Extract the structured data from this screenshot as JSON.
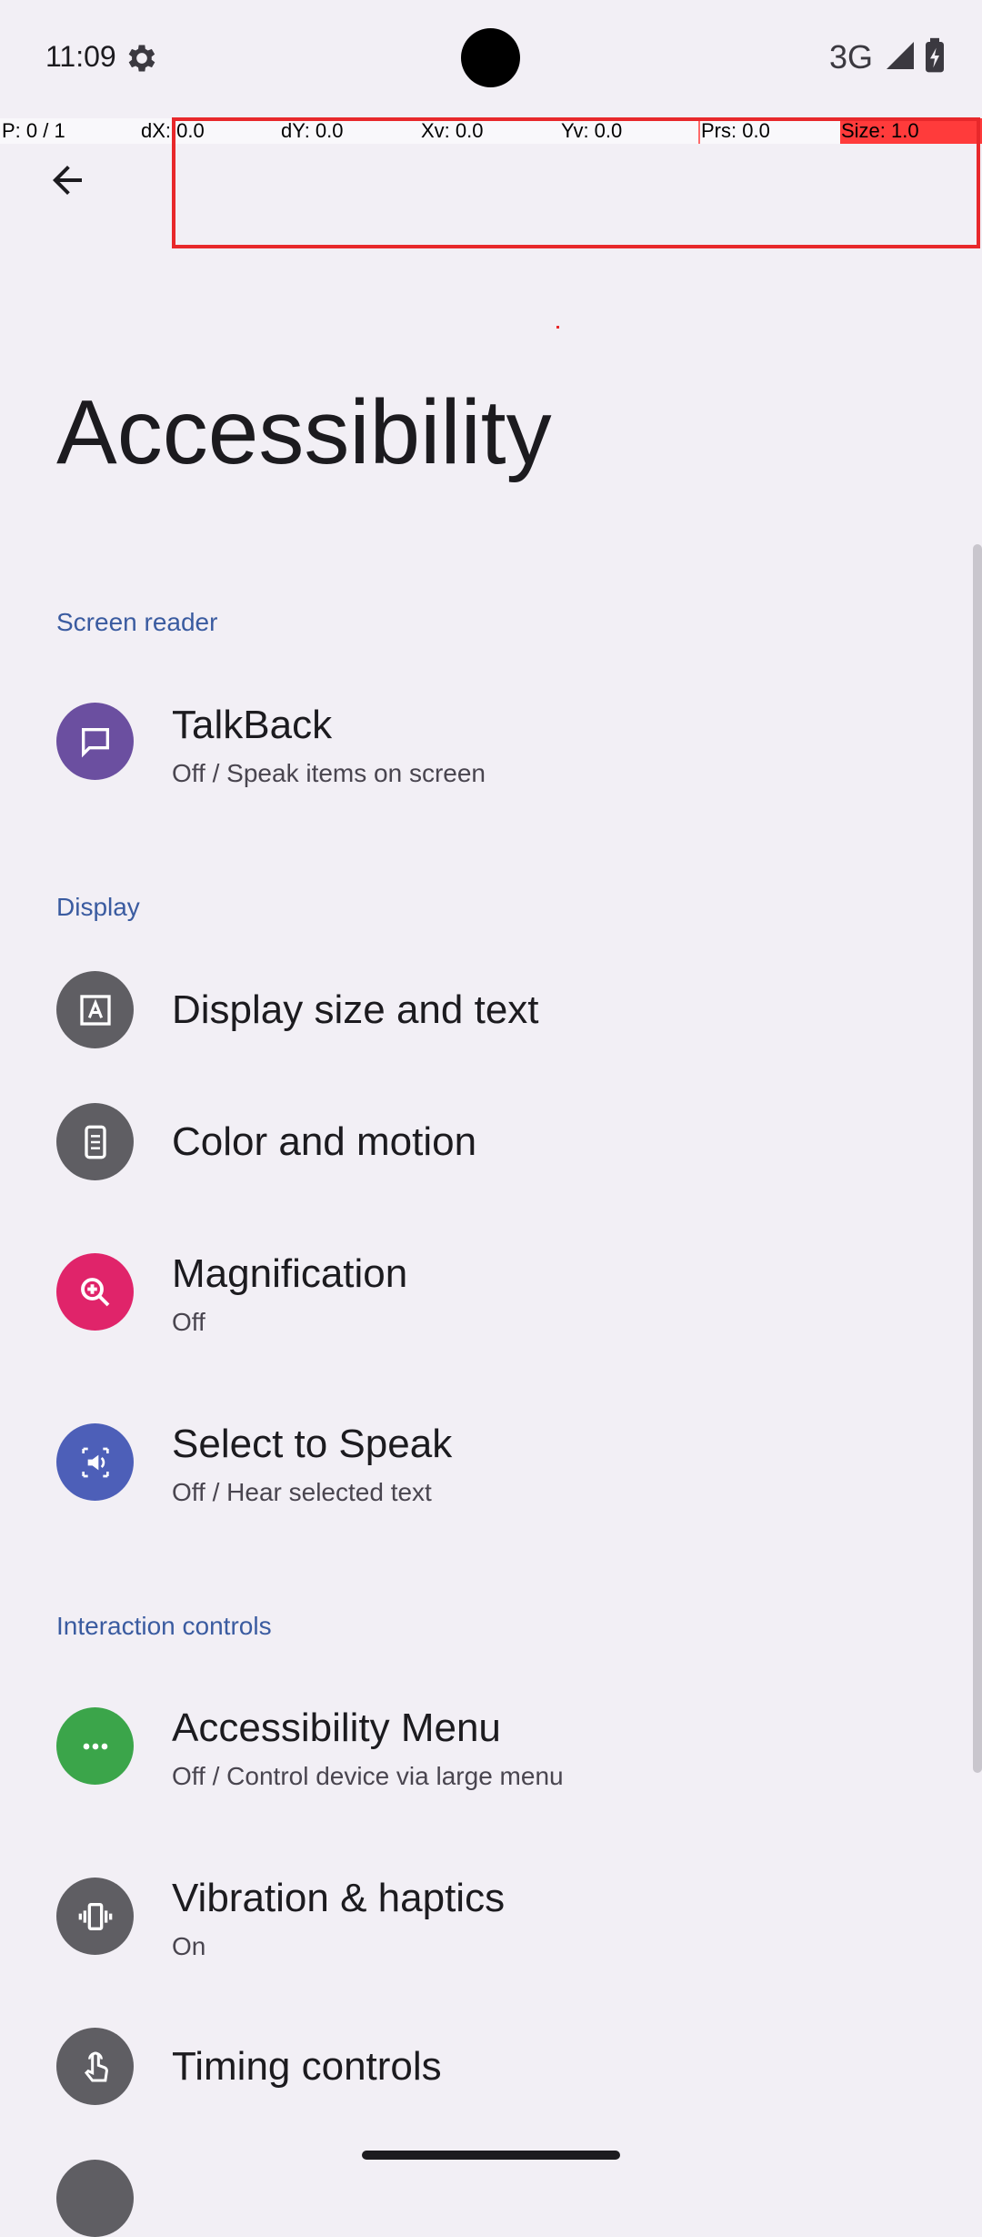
{
  "status_bar": {
    "time": "11:09",
    "network": "3G"
  },
  "pointer_overlay": {
    "p": "P: 0 / 1",
    "dx": "dX: 0.0",
    "dy": "dY: 0.0",
    "xv": "Xv: 0.0",
    "yv": "Yv: 0.0",
    "prs": "Prs: 0.0",
    "size": "Size: 1.0"
  },
  "app_bar": {
    "title": "Accessibility"
  },
  "sections": {
    "screen_reader": {
      "header": "Screen reader",
      "talkback": {
        "title": "TalkBack",
        "summary": "Off / Speak items on screen"
      }
    },
    "display": {
      "header": "Display",
      "display_size": {
        "title": "Display size and text"
      },
      "color_motion": {
        "title": "Color and motion"
      },
      "magnification": {
        "title": "Magnification",
        "summary": "Off"
      },
      "select_to_speak": {
        "title": "Select to Speak",
        "summary": "Off / Hear selected text"
      }
    },
    "interaction": {
      "header": "Interaction controls",
      "accessibility_menu": {
        "title": "Accessibility Menu",
        "summary": "Off / Control device via large menu"
      },
      "vibration": {
        "title": "Vibration & haptics",
        "summary": "On"
      },
      "timing": {
        "title": "Timing controls"
      }
    }
  },
  "colors": {
    "background": "#F2EFF5",
    "section_header": "#3A5BA0",
    "talkback_icon": "#6B4FA0",
    "display_icon": "#5F5E63",
    "magnification_icon": "#E0246A",
    "select_to_speak_icon": "#4D5FB8",
    "accessibility_menu_icon": "#3BA54A"
  }
}
